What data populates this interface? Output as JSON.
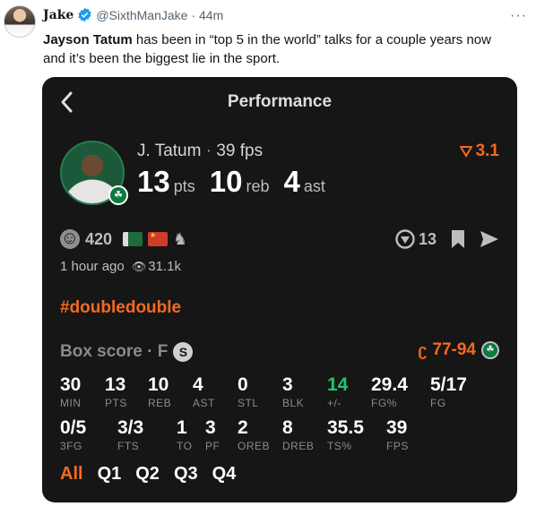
{
  "tweet": {
    "author_name": "Jake",
    "handle": "@SixthManJake",
    "time": "· 44m",
    "more": "···",
    "text_bold": "Jayson Tatum",
    "text_line1": " has been in “top 5 in the world” talks for a couple years now",
    "text_line2": "and it’s been the biggest lie in the sport."
  },
  "card": {
    "title": "Performance",
    "player": {
      "name": "J. Tatum",
      "sep": " · ",
      "fps": "39 fps",
      "rating": "3.1",
      "pts": "13",
      "pts_label": "pts",
      "reb": "10",
      "reb_label": "reb",
      "ast": "4",
      "ast_label": "ast"
    },
    "reactions": {
      "count": "420",
      "comments": "13"
    },
    "posted": "1 hour ago",
    "views": "31.1k",
    "hashtag": "#doubledouble",
    "box_score": {
      "title": "Box score · F",
      "badge": "S",
      "score": "77-94",
      "row1": [
        {
          "value": "30",
          "label": "MIN"
        },
        {
          "value": "13",
          "label": "PTS"
        },
        {
          "value": "10",
          "label": "REB"
        },
        {
          "value": "4",
          "label": "AST"
        },
        {
          "value": "0",
          "label": "STL"
        },
        {
          "value": "3",
          "label": "BLK"
        },
        {
          "value": "14",
          "label": "+/-"
        },
        {
          "value": "29.4",
          "label": "FG%"
        },
        {
          "value": "5/17",
          "label": "FG"
        }
      ],
      "row2": [
        {
          "value": "0/5",
          "label": "3FG"
        },
        {
          "value": "3/3",
          "label": "FTS"
        },
        {
          "value": "1",
          "label": "TO"
        },
        {
          "value": "3",
          "label": "PF"
        },
        {
          "value": "2",
          "label": "OREB"
        },
        {
          "value": "8",
          "label": "DREB"
        },
        {
          "value": "35.5",
          "label": "TS%"
        },
        {
          "value": "39",
          "label": "FPS"
        }
      ]
    },
    "tabs": [
      "All",
      "Q1",
      "Q2",
      "Q3",
      "Q4"
    ],
    "colors": {
      "accent": "#f26a21",
      "positive": "#1ec773",
      "card_bg": "#161616"
    }
  }
}
